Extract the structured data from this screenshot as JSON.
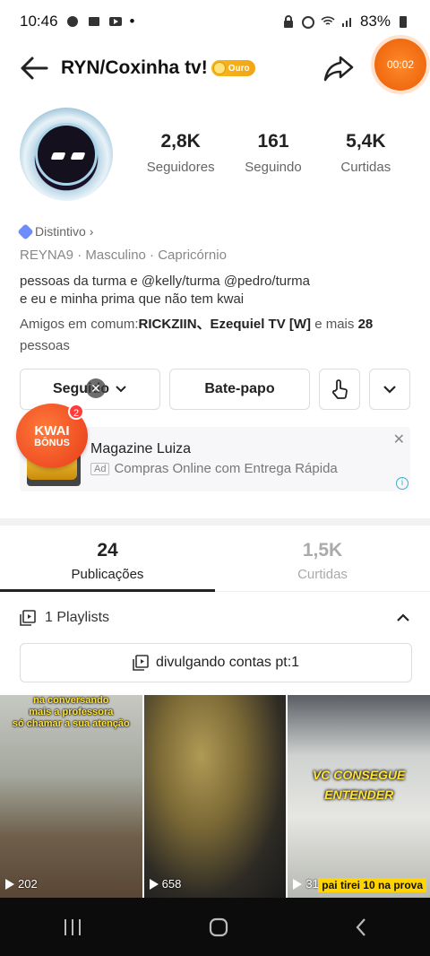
{
  "status_bar": {
    "time": "10:46",
    "battery": "83%"
  },
  "header": {
    "title": "RYN/Coxinha tv!",
    "badge": "Ouro",
    "timer": "00:02"
  },
  "stats": [
    {
      "value": "2,8K",
      "label": "Seguidores"
    },
    {
      "value": "161",
      "label": "Seguindo"
    },
    {
      "value": "5,4K",
      "label": "Curtidas"
    }
  ],
  "profile": {
    "distintivo": "Distintivo",
    "meta": "REYNA9 · Masculino · Capricórnio",
    "bio_line1": "pessoas da turma e @kelly/turma @pedro/turma",
    "bio_line2": " e eu e minha prima que não tem kwai",
    "friends_prefix": "Amigos em comum:",
    "friends_names": "RICKZIIN、Ezequiel TV [W]",
    "friends_mid": " e mais ",
    "friends_count": "28",
    "friends_suffix": "pessoas"
  },
  "actions": {
    "following": "Seguido",
    "chat": "Bate-papo"
  },
  "ad": {
    "title": "Magazine Luiza",
    "tag": "Ad",
    "subtitle": "Compras Online com Entrega Rápida"
  },
  "kwai_bonus": {
    "line1": "KWAI",
    "line2": "BÔNUS",
    "count": "2"
  },
  "tabs": [
    {
      "value": "24",
      "label": "Publicações"
    },
    {
      "value": "1,5K",
      "label": "Curtidas"
    }
  ],
  "playlists": {
    "label": "1 Playlists",
    "chip": "divulgando contas pt:1"
  },
  "videos": [
    {
      "views": "202",
      "caption_top_1": "na conversando",
      "caption_top_2": "mais a professora",
      "caption_top_3": "só chamar a sua atenção"
    },
    {
      "views": "658"
    },
    {
      "views": "310",
      "caption_mid_1": "VC CONSEGUE",
      "caption_mid_2": "ENTENDER",
      "caption_bottom": "pai tirei 10 na prova"
    }
  ]
}
